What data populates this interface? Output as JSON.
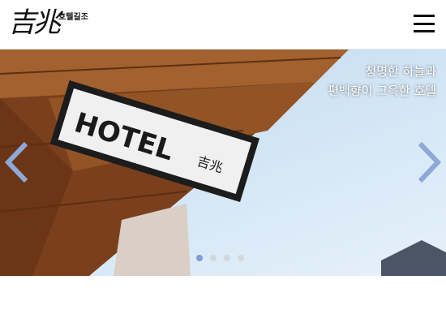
{
  "header": {
    "logo_mark": "吉兆",
    "logo_text": "호텔길조",
    "menu_icon": "hamburger-menu-icon"
  },
  "slider": {
    "caption_line1": "청명한 하늘과",
    "caption_line2": "편백향이 그윽한 호텔",
    "sign_text": "HOTEL",
    "sign_hanja": "吉兆",
    "prev_icon": "chevron-left-icon",
    "next_icon": "chevron-right-icon",
    "dots": [
      {
        "active": true
      },
      {
        "active": false
      },
      {
        "active": false
      },
      {
        "active": false
      }
    ],
    "colors": {
      "arrow": "#8ea8d8",
      "dot_active": "#7f9bd0",
      "dot_inactive": "#d2d8de",
      "wood": "#8a4a22"
    }
  }
}
